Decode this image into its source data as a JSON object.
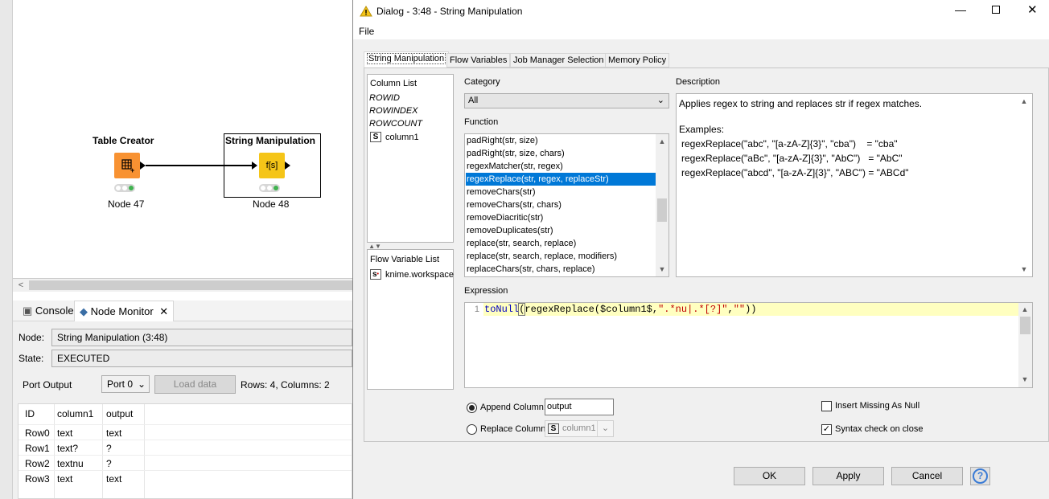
{
  "workflow": {
    "nodes": [
      {
        "title": "Table Creator",
        "label": "Node 47",
        "icon": "table-icon"
      },
      {
        "title": "String Manipulation",
        "label": "Node 48",
        "icon_text": "f[s]"
      }
    ]
  },
  "bottom": {
    "tabs": [
      "Console",
      "Node Monitor"
    ],
    "node_label": "Node:",
    "node_value": "String Manipulation  (3:48)",
    "state_label": "State:",
    "state_value": "EXECUTED",
    "port_output_label": "Port Output",
    "port_select": "Port 0",
    "load_button": "Load data",
    "rows_info": "Rows: 4, Columns: 2",
    "table": {
      "headers": [
        "ID",
        "column1",
        "output"
      ],
      "rows": [
        [
          "Row0",
          "text",
          "text"
        ],
        [
          "Row1",
          "text?",
          "?"
        ],
        [
          "Row2",
          "textnu",
          "?"
        ],
        [
          "Row3",
          "text",
          "text"
        ]
      ]
    }
  },
  "dialog": {
    "title": "Dialog - 3:48 - String Manipulation",
    "menu": [
      "File"
    ],
    "tabs": [
      "String Manipulation",
      "Flow Variables",
      "Job Manager Selection",
      "Memory Policy"
    ],
    "column_list_label": "Column List",
    "columns": [
      "ROWID",
      "ROWINDEX",
      "ROWCOUNT",
      "column1"
    ],
    "column_type_icon": "S",
    "flow_var_label": "Flow Variable List",
    "flow_vars": [
      "knime.workspace"
    ],
    "category_label": "Category",
    "category_value": "All",
    "function_label": "Function",
    "functions": [
      "padRight(str, size)",
      "padRight(str, size, chars)",
      "regexMatcher(str, regex)",
      "regexReplace(str, regex, replaceStr)",
      "removeChars(str)",
      "removeChars(str, chars)",
      "removeDiacritic(str)",
      "removeDuplicates(str)",
      "replace(str, search, replace)",
      "replace(str, search, replace, modifiers)",
      "replaceChars(str, chars, replace)"
    ],
    "description_label": "Description",
    "description": {
      "text": "Applies regex to string and replaces str if regex matches.",
      "examples_label": "Examples:",
      "examples": [
        "regexReplace(\"abc\", \"[a-zA-Z]{3}\", \"cba\")    = \"cba\"",
        "regexReplace(\"aBc\", \"[a-zA-Z]{3}\", \"AbC\")   = \"AbC\"",
        "regexReplace(\"abcd\", \"[a-zA-Z]{3}\", \"ABC\") = \"ABCd\""
      ]
    },
    "expression_label": "Expression",
    "expression": {
      "line_number": "1",
      "code_fn1": "toNull",
      "code_paren": "(",
      "code_fn2": "regexReplace($column1$,",
      "code_str1": "\".*nu|.*[?]\"",
      "code_comma": ",",
      "code_str2": "\"\"",
      "code_end": "))"
    },
    "append_label": "Append Column:",
    "append_value": "output",
    "replace_label": "Replace Column:",
    "replace_value": "column1",
    "insert_missing_label": "Insert Missing As Null",
    "syntax_check_label": "Syntax check on close",
    "buttons": {
      "ok": "OK",
      "apply": "Apply",
      "cancel": "Cancel",
      "help": "?"
    },
    "colors": {
      "selection": "#0078d7",
      "expression_highlight": "#ffffc0",
      "warning": "#f5c518"
    }
  }
}
